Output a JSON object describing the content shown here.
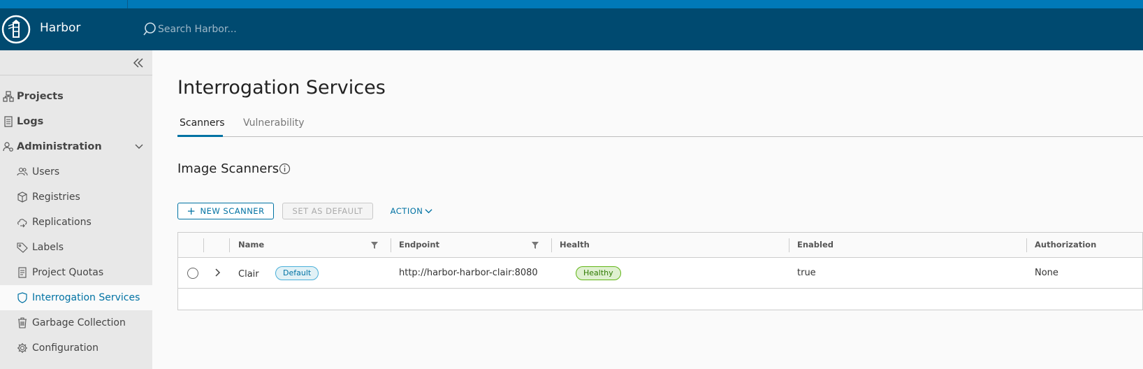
{
  "header": {
    "app_title": "Harbor",
    "search_placeholder": "Search Harbor..."
  },
  "sidebar": {
    "items": [
      {
        "label": "Projects",
        "icon": "projects-icon"
      },
      {
        "label": "Logs",
        "icon": "logs-icon"
      },
      {
        "label": "Administration",
        "icon": "administration-icon"
      }
    ],
    "admin_items": [
      {
        "label": "Users",
        "icon": "users-icon"
      },
      {
        "label": "Registries",
        "icon": "registries-icon"
      },
      {
        "label": "Replications",
        "icon": "replications-icon"
      },
      {
        "label": "Labels",
        "icon": "labels-icon"
      },
      {
        "label": "Project Quotas",
        "icon": "project-quotas-icon"
      },
      {
        "label": "Interrogation Services",
        "icon": "interrogation-services-icon",
        "active": true
      },
      {
        "label": "Garbage Collection",
        "icon": "garbage-collection-icon"
      },
      {
        "label": "Configuration",
        "icon": "configuration-icon"
      }
    ]
  },
  "main": {
    "page_title": "Interrogation Services",
    "tabs": [
      {
        "label": "Scanners",
        "active": true
      },
      {
        "label": "Vulnerability",
        "active": false
      }
    ],
    "section_title": "Image Scanners",
    "buttons": {
      "new_scanner": "NEW SCANNER",
      "set_as_default": "SET AS DEFAULT",
      "action": "ACTION"
    },
    "table": {
      "columns": [
        "Name",
        "Endpoint",
        "Health",
        "Enabled",
        "Authorization"
      ],
      "rows": [
        {
          "name": "Clair",
          "badge": "Default",
          "endpoint": "http://harbor-harbor-clair:8080",
          "health": "Healthy",
          "enabled": "true",
          "authorization": "None"
        }
      ]
    }
  },
  "colors": {
    "header_bg": "#004a70",
    "top_strip": "#0079b8",
    "accent": "#0072a3",
    "healthy": "#60b515"
  }
}
